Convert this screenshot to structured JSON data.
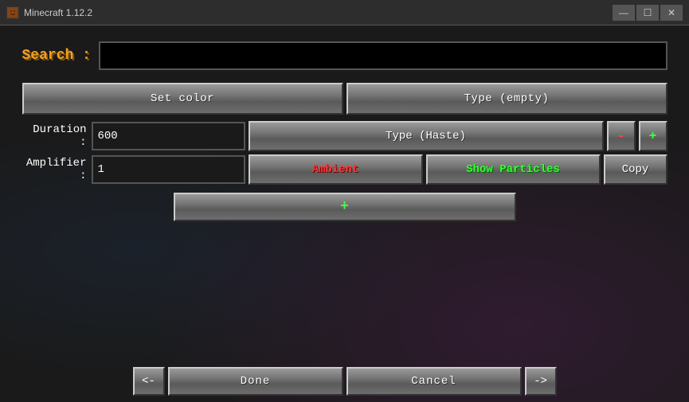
{
  "titlebar": {
    "app_name": "Minecraft 1.12.2",
    "minimize": "—",
    "maximize": "☐",
    "close": "✕"
  },
  "search": {
    "label": "Search :",
    "placeholder": "",
    "value": ""
  },
  "top_buttons": {
    "set_color": "Set color",
    "type_empty": "Type (empty)"
  },
  "effect": {
    "duration_label": "Duration :",
    "duration_value": "600",
    "amplifier_label": "Amplifier :",
    "amplifier_value": "1",
    "type_haste": "Type (Haste)",
    "minus": "-",
    "plus": "+",
    "ambient": "Ambient",
    "show_particles": "Show Particles",
    "copy": "Copy"
  },
  "add_button": "+",
  "bottom_nav": {
    "prev": "<-",
    "done": "Done",
    "cancel": "Cancel",
    "next": "->"
  }
}
